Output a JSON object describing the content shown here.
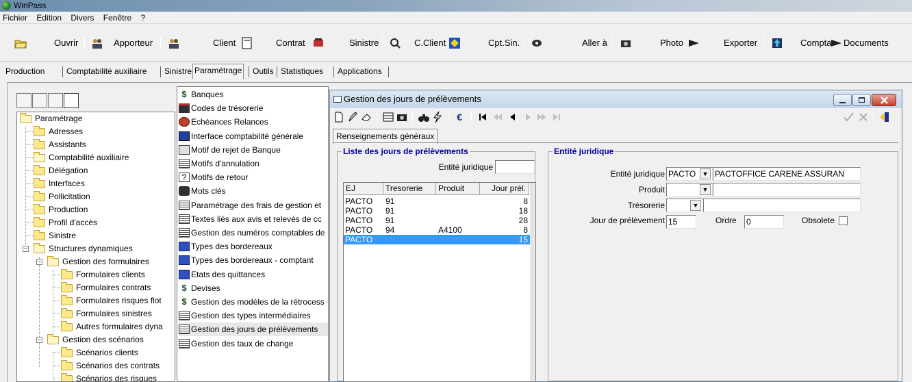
{
  "window": {
    "title": "WinPass"
  },
  "menu": [
    "Fichier",
    "Edition",
    "Divers",
    "Fenêtre",
    "?"
  ],
  "toolbar": {
    "ouvrir": "Ouvrir",
    "apporteur": "Apporteur",
    "client": "Client",
    "contrat": "Contrat",
    "sinistre": "Sinistre",
    "cclient": "C.Client",
    "cptsin": "Cpt.Sin.",
    "aller": "Aller à",
    "photo": "Photo",
    "exporter": "Exporter",
    "compta": "Compta",
    "documents": "Documents"
  },
  "tabs": [
    "Production",
    "Comptabilité auxiliaire",
    "Sinistre",
    "Paramétrage",
    "Outils",
    "Statistiques",
    "Applications"
  ],
  "active_tab": "Paramétrage",
  "tree": {
    "root": "Paramétrage",
    "items": [
      "Adresses",
      "Assistants",
      "Comptabilité auxiliaire",
      "Délégation",
      "Interfaces",
      "Pollicitation",
      "Production",
      "Profil d'accès",
      "Sinistre"
    ],
    "structures": "Structures dynamiques",
    "gestion_formulaires": "Gestion des formulaires",
    "formulaires": [
      "Formulaires clients",
      "Formulaires contrats",
      "Formulaires risques flot",
      "Formulaires sinistres",
      "Autres formulaires dyna"
    ],
    "gestion_scenarios": "Gestion des scénarios",
    "scenarios": [
      "Scénarios clients",
      "Scénarios des contrats",
      "Scénarios des risques"
    ]
  },
  "list": [
    "Banques",
    "Codes de trésorerie",
    "Echéances Relances",
    "Interface comptabilité générale",
    "Motif de rejet de Banque",
    "Motifs d'annulation",
    "Motifs de retour",
    "Mots clés",
    "Paramétrage des frais de gestion et",
    "Textes liés aux avis et relevés de cc",
    "Gestion des numéros comptables de",
    "Types des bordereaux",
    "Types des bordereaux - comptant",
    "Etats des quittances",
    "Devises",
    "Gestion des modèles de la rétrocess",
    "Gestion des types intermédiaires",
    "Gestion des jours de prélèvements",
    "Gestion des taux de change"
  ],
  "dialog": {
    "title": "Gestion des jours de prélèvements",
    "tab": "Renseignements généraux",
    "left_group": {
      "title": "Liste des jours de prélèvements",
      "filter_label": "Entité juridique",
      "filter_value": "",
      "columns": [
        "EJ",
        "Tresorerie",
        "Produit",
        "Jour prél."
      ],
      "rows": [
        [
          "PACTO",
          "91",
          "",
          "8"
        ],
        [
          "PACTO",
          "91",
          "",
          "18"
        ],
        [
          "PACTO",
          "91",
          "",
          "28"
        ],
        [
          "PACTO",
          "94",
          "A4100",
          "8"
        ],
        [
          "PACTO",
          "",
          "",
          "15"
        ]
      ],
      "selected_row": 4
    },
    "right_group": {
      "title": "Entité juridique",
      "entite_label": "Entité juridique",
      "entite_code": "PACTO",
      "entite_name": "PACTOFFICE CARENE ASSURAN",
      "produit_label": "Produit",
      "produit_value": "",
      "tresorerie_label": "Trésorerie",
      "tresorerie_value": "",
      "jour_label": "Jour de prélèvement",
      "jour_value": "15",
      "ordre_label": "Ordre",
      "ordre_value": "0",
      "obsolete_label": "Obsolete"
    }
  },
  "colors": {
    "selection": "#3399ff",
    "group_title": "#0000a0",
    "close": "#c2432e"
  }
}
